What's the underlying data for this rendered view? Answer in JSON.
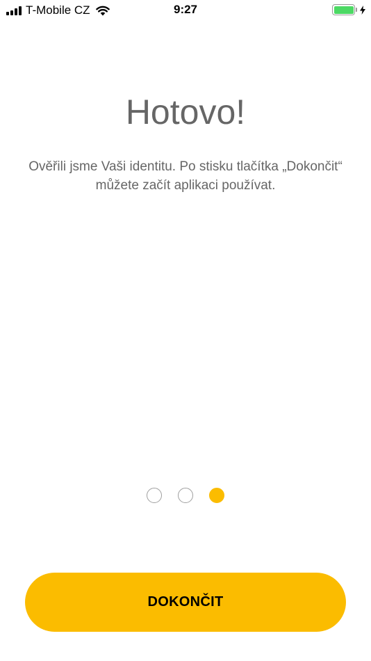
{
  "status_bar": {
    "carrier": "T-Mobile CZ",
    "time": "9:27",
    "battery_level": 1.0,
    "battery_color": "#4cd964",
    "icons": [
      "signal-icon",
      "wifi-icon",
      "battery-icon",
      "charging-bolt-icon"
    ]
  },
  "main": {
    "title": "Hotovo!",
    "message": "Ověřili jsme Vaši identitu. Po stisku tlačítka „Dokončit“ můžete začít aplikaci používat."
  },
  "pager": {
    "total": 3,
    "active_index": 2
  },
  "actions": {
    "finish_label": "DOKONČIT"
  },
  "colors": {
    "accent": "#fbbc00",
    "text": "#666666",
    "dot_border": "#9e9e9e"
  }
}
